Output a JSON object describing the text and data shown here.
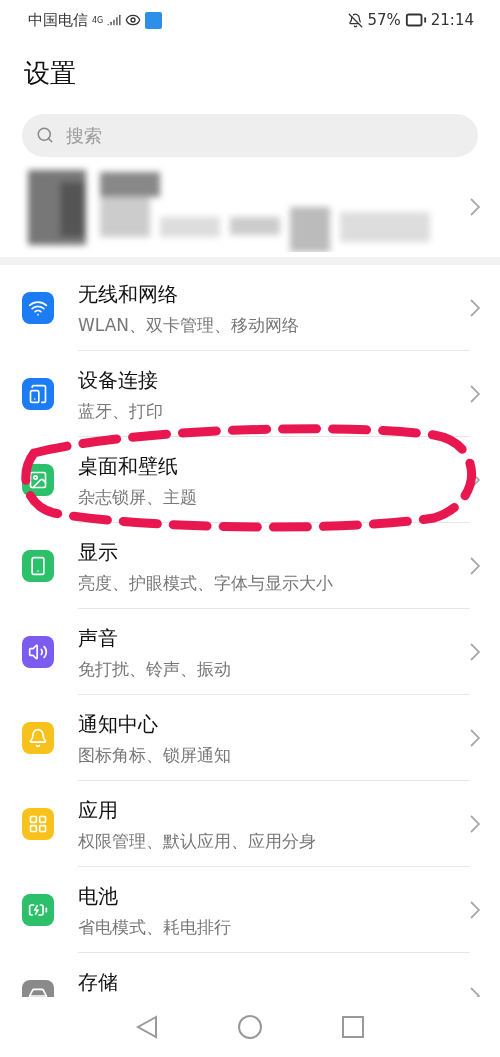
{
  "status_bar": {
    "carrier": "中国电信",
    "network": "4G",
    "battery": "57%",
    "time": "21:14"
  },
  "title": "设置",
  "search": {
    "placeholder": "搜索"
  },
  "items": [
    {
      "title": "无线和网络",
      "subtitle": "WLAN、双卡管理、移动网络",
      "color": "#1b7cf4",
      "circled": false
    },
    {
      "title": "设备连接",
      "subtitle": "蓝牙、打印",
      "color": "#1b7cf4",
      "circled": false
    },
    {
      "title": "桌面和壁纸",
      "subtitle": "杂志锁屏、主题",
      "color": "#2cc06a",
      "circled": true
    },
    {
      "title": "显示",
      "subtitle": "亮度、护眼模式、字体与显示大小",
      "color": "#2cc06a",
      "circled": false
    },
    {
      "title": "声音",
      "subtitle": "免打扰、铃声、振动",
      "color": "#7c5cf0",
      "circled": false
    },
    {
      "title": "通知中心",
      "subtitle": "图标角标、锁屏通知",
      "color": "#f8c21c",
      "circled": false
    },
    {
      "title": "应用",
      "subtitle": "权限管理、默认应用、应用分身",
      "color": "#f8c21c",
      "circled": false
    },
    {
      "title": "电池",
      "subtitle": "省电模式、耗电排行",
      "color": "#2cc06a",
      "circled": false
    },
    {
      "title": "存储",
      "color": "#8a8a8a",
      "circled": false
    }
  ]
}
